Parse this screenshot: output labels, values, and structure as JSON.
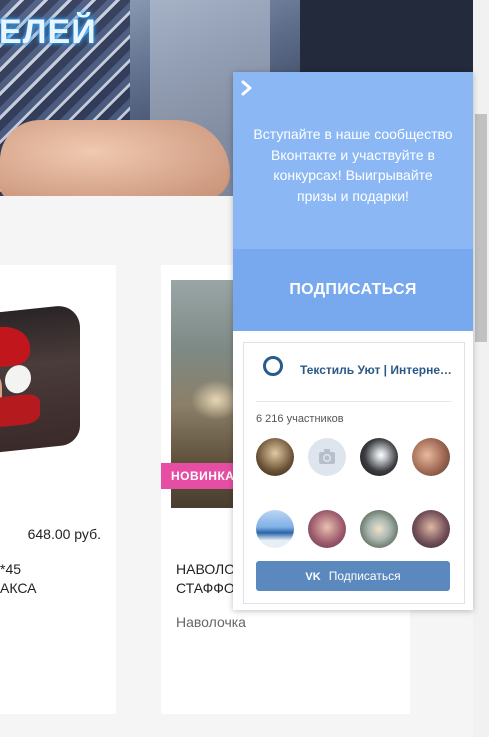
{
  "hero": {
    "title": "ЕЛЕЙ"
  },
  "products": [
    {
      "price": "648.00 руб.",
      "title": "*45\nАКСА"
    },
    {
      "badge": "НОВИНКА",
      "title": "НАВОЛО\nСТАФФО",
      "subtitle": "Наволочка"
    }
  ],
  "widget": {
    "close_icon": "chevron-right-icon",
    "promo_text": "Вступайте в наше сообщество Вконтакте и участвуйте в конкурсах! Выигрывайте призы и подарки!",
    "subscribe_label": "ПОДПИСАТЬСЯ",
    "vk": {
      "group_name": "Текстиль Уют | Интернет-магазин",
      "members": "6 216 участников",
      "button_label": "Подписаться",
      "button_icon": "vk-logo-icon"
    }
  },
  "colors": {
    "panel_top": "#8bb8f5",
    "subscribe_bg": "#78a8ee",
    "vk_button": "#5b88bd",
    "badge": "#e64ea4"
  }
}
